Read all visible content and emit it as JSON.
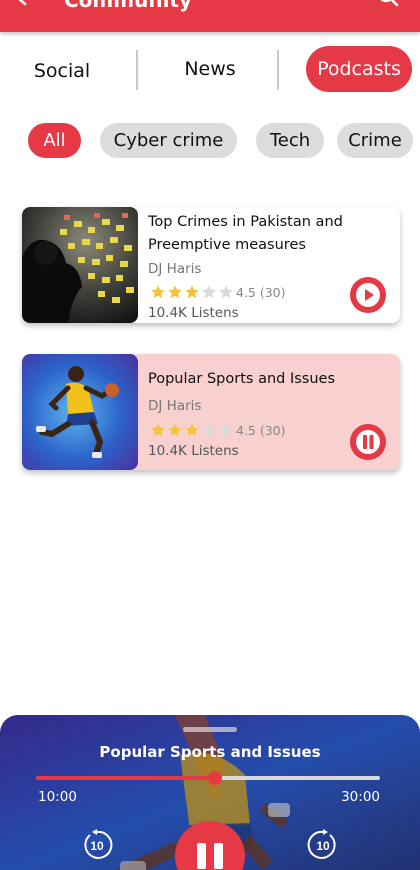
{
  "appbar": {
    "title": "Community",
    "accent": "#e63946"
  },
  "tabs": [
    {
      "label": "Social",
      "active": false
    },
    {
      "label": "News",
      "active": false
    },
    {
      "label": "Podcasts",
      "active": true
    }
  ],
  "chips": [
    {
      "label": "All",
      "active": true
    },
    {
      "label": "Cyber crime",
      "active": false
    },
    {
      "label": "Tech",
      "active": false
    },
    {
      "label": "Crime",
      "active": false
    }
  ],
  "podcasts": [
    {
      "title": "Top Crimes in Pakistan and Preemptive measures",
      "author": "DJ Haris",
      "rating": 4.5,
      "rating_text": "4.5 (30)",
      "stars_filled": 3,
      "stars_total": 5,
      "listens": "10.4K Listens",
      "state": "play"
    },
    {
      "title": "Popular Sports and Issues",
      "author": "DJ Haris",
      "rating": 4.5,
      "rating_text": "4.5 (30)",
      "stars_filled": 3,
      "stars_total": 5,
      "listens": "10.4K Listens",
      "state": "pause"
    }
  ],
  "player": {
    "title": "Popular Sports and Issues",
    "current_time": "10:00",
    "total_time": "30:00",
    "progress": 0.52,
    "skip_back_label": "10",
    "skip_forward_label": "10"
  },
  "colors": {
    "accent": "#e63946",
    "chip_bg": "#dcdcdc",
    "card_active_bg": "#f8d0d0",
    "star_filled": "#f5c33b",
    "star_empty": "#d9d9d9"
  }
}
